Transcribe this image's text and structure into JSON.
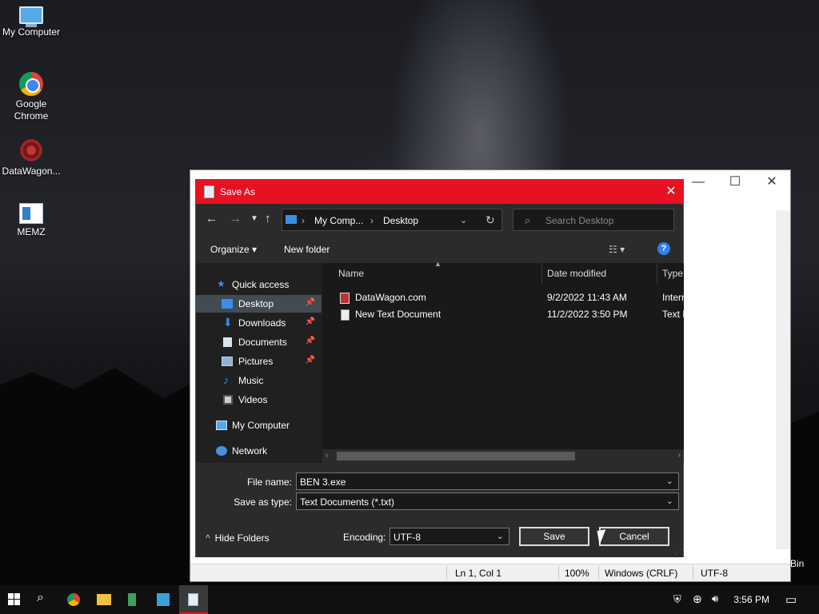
{
  "desktop": {
    "icons": [
      {
        "label": "My Computer",
        "icon": "computer-icon"
      },
      {
        "label": "Google Chrome",
        "icon": "chrome-icon"
      },
      {
        "label": "DataWagon...",
        "icon": "datawagon-icon"
      },
      {
        "label": "MEMZ",
        "icon": "memz-icon"
      }
    ],
    "recycle_partial": "Bin"
  },
  "notepad": {
    "status": {
      "position": "Ln 1, Col 1",
      "zoom": "100%",
      "line_ending": "Windows (CRLF)",
      "encoding": "UTF-8"
    }
  },
  "dialog": {
    "title": "Save As",
    "close_glyph": "✕",
    "address": {
      "segment1": "My Comp...",
      "segment2": "Desktop"
    },
    "search_placeholder": "Search Desktop",
    "toolbar": {
      "organize": "Organize",
      "new_folder": "New folder",
      "help": "?"
    },
    "nav": {
      "quick_access": "Quick access",
      "items": [
        {
          "label": "Desktop",
          "pinned": true
        },
        {
          "label": "Downloads",
          "pinned": true
        },
        {
          "label": "Documents",
          "pinned": true
        },
        {
          "label": "Pictures",
          "pinned": true
        },
        {
          "label": "Music",
          "pinned": false
        },
        {
          "label": "Videos",
          "pinned": false
        }
      ],
      "my_computer": "My Computer",
      "network": "Network"
    },
    "columns": {
      "name": "Name",
      "date": "Date modified",
      "type": "Type"
    },
    "files": [
      {
        "name": "DataWagon.com",
        "date": "9/2/2022 11:43 AM",
        "type": "Interr"
      },
      {
        "name": "New Text Document",
        "date": "11/2/2022 3:50 PM",
        "type": "Text D"
      }
    ],
    "file_name_label": "File name:",
    "file_name_value": "BEN 3.exe",
    "save_type_label": "Save as type:",
    "save_type_value": "Text Documents (*.txt)",
    "hide_folders": "Hide Folders",
    "encoding_label": "Encoding:",
    "encoding_value": "UTF-8",
    "save_button": "Save",
    "cancel_button": "Cancel"
  },
  "taskbar": {
    "time": "3:56 PM"
  },
  "colors": {
    "accent": "#e81123",
    "dialog_bg": "#202020",
    "panel_bg": "#2b2b2b",
    "selection": "#444a52"
  }
}
